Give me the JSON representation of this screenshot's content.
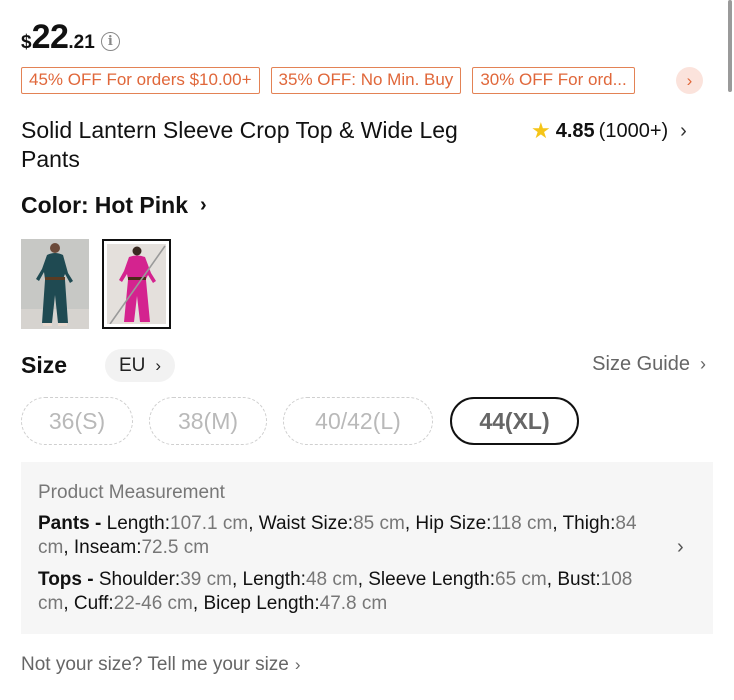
{
  "price": {
    "currency": "$",
    "integer": "22",
    "decimal": ".21"
  },
  "coupons": [
    "45% OFF For orders $10.00+",
    "35% OFF: No Min. Buy",
    "30% OFF For ord..."
  ],
  "product": {
    "title": "Solid Lantern Sleeve Crop Top & Wide Leg Pants",
    "rating": "4.85",
    "review_count": "(1000+)"
  },
  "color": {
    "label": "Color:",
    "value": "Hot Pink",
    "options": [
      "Dark Green",
      "Hot Pink"
    ],
    "selected_index": 1
  },
  "size": {
    "label": "Size",
    "region": "EU",
    "guide_label": "Size Guide",
    "options": [
      {
        "label": "36(S)",
        "available": false
      },
      {
        "label": "38(M)",
        "available": false
      },
      {
        "label": "40/42(L)",
        "available": false
      },
      {
        "label": "44(XL)",
        "available": false,
        "selected": true
      }
    ]
  },
  "measurement": {
    "title": "Product Measurement",
    "pants": {
      "label": "Pants -",
      "items": [
        {
          "k": "Length:",
          "v": "107.1 cm"
        },
        {
          "k": "Waist Size:",
          "v": "85 cm"
        },
        {
          "k": "Hip Size:",
          "v": "118 cm"
        },
        {
          "k": "Thigh:",
          "v": "84 cm"
        },
        {
          "k": "Inseam:",
          "v": "72.5 cm"
        }
      ]
    },
    "tops": {
      "label": "Tops -",
      "items": [
        {
          "k": "Shoulder:",
          "v": "39 cm"
        },
        {
          "k": "Length:",
          "v": "48 cm"
        },
        {
          "k": "Sleeve Length:",
          "v": "65 cm"
        },
        {
          "k": "Bust:",
          "v": "108 cm"
        },
        {
          "k": "Cuff:",
          "v": "22-46 cm"
        },
        {
          "k": "Bicep Length:",
          "v": "47.8 cm"
        }
      ]
    }
  },
  "footer": {
    "link": "Not your size? Tell me your size"
  },
  "icons": {
    "info": "ⓘ",
    "chevron_right": "›",
    "star": "★"
  },
  "colors": {
    "accent_orange": "#e0673a",
    "coupon_bg": "#fbe3dc",
    "star": "#f5c518",
    "swatch_green": "#1f4a52",
    "swatch_pink": "#d4238f"
  }
}
